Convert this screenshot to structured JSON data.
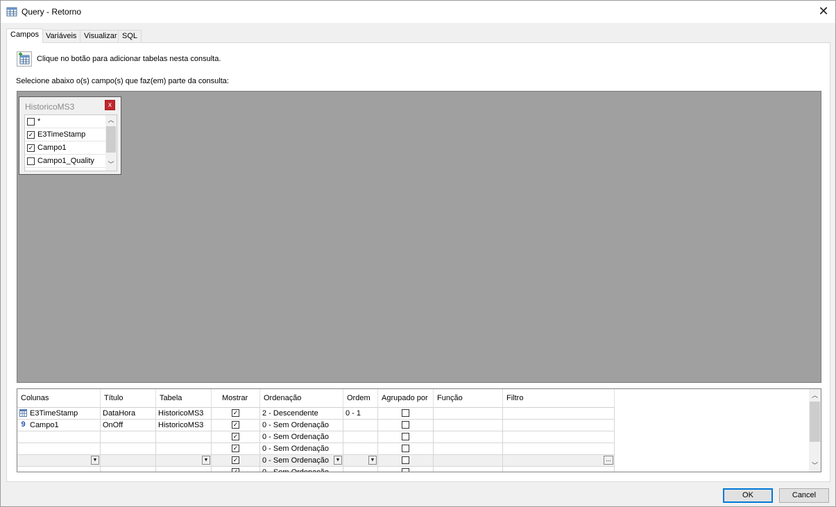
{
  "window": {
    "title": "Query - Retorno",
    "icon": "table-grid-icon",
    "close_icon": "close-icon"
  },
  "tabs": [
    {
      "label": "Campos",
      "active": true
    },
    {
      "label": "Variáveis",
      "active": false
    },
    {
      "label": "Visualizar",
      "active": false
    },
    {
      "label": "SQL",
      "active": false
    }
  ],
  "campos": {
    "add_table_hint": "Clique no botão para adicionar tabelas nesta consulta.",
    "select_fields_hint": "Selecione abaixo o(s) campo(s) que faz(em) parte da consulta:",
    "diagram_bg": "#a0a0a0"
  },
  "table_box": {
    "title": "HistoricoMS3",
    "close_symbol": "x",
    "fields": [
      {
        "name": "*",
        "checked": false
      },
      {
        "name": "E3TimeStamp",
        "checked": true
      },
      {
        "name": "Campo1",
        "checked": true
      },
      {
        "name": "Campo1_Quality",
        "checked": false
      }
    ]
  },
  "grid": {
    "headers": [
      "Colunas",
      "Título",
      "Tabela",
      "Mostrar",
      "Ordenação",
      "Ordem",
      "Agrupado por",
      "Função",
      "Filtro"
    ],
    "rows": [
      {
        "icon": "datetime-field-icon",
        "coluna": "E3TimeStamp",
        "titulo": "DataHora",
        "tabela": "HistoricoMS3",
        "mostrar": true,
        "ordenacao": "2 - Descendente",
        "ordem": "0 - 1",
        "agrupado": false,
        "funcao": "",
        "filtro": ""
      },
      {
        "icon": "numeric-field-icon",
        "coluna": "Campo1",
        "titulo": "OnOff",
        "tabela": "HistoricoMS3",
        "mostrar": true,
        "ordenacao": "0 - Sem Ordenação",
        "ordem": "",
        "agrupado": false,
        "funcao": "",
        "filtro": ""
      },
      {
        "icon": "",
        "coluna": "",
        "titulo": "",
        "tabela": "",
        "mostrar": true,
        "ordenacao": "0 - Sem Ordenação",
        "ordem": "",
        "agrupado": false,
        "funcao": "",
        "filtro": ""
      },
      {
        "icon": "",
        "coluna": "",
        "titulo": "",
        "tabela": "",
        "mostrar": true,
        "ordenacao": "0 - Sem Ordenação",
        "ordem": "",
        "agrupado": false,
        "funcao": "",
        "filtro": ""
      },
      {
        "icon": "",
        "coluna": "",
        "titulo": "",
        "tabela": "",
        "mostrar": true,
        "ordenacao": "0 - Sem Ordenação",
        "ordem": "",
        "agrupado": false,
        "funcao": "",
        "filtro": "",
        "editing": true
      },
      {
        "icon": "",
        "coluna": "",
        "titulo": "",
        "tabela": "",
        "mostrar": true,
        "ordenacao": "0 - Sem Ordenação",
        "ordem": "",
        "agrupado": false,
        "funcao": "",
        "filtro": ""
      }
    ]
  },
  "buttons": {
    "ok": "OK",
    "cancel": "Cancel"
  }
}
